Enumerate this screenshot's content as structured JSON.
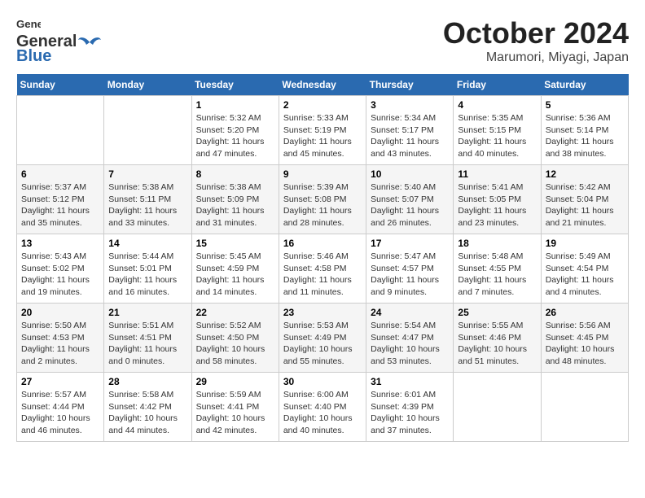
{
  "logo": {
    "general": "General",
    "blue": "Blue"
  },
  "title": "October 2024",
  "location": "Marumori, Miyagi, Japan",
  "days_of_week": [
    "Sunday",
    "Monday",
    "Tuesday",
    "Wednesday",
    "Thursday",
    "Friday",
    "Saturday"
  ],
  "weeks": [
    [
      {
        "day": "",
        "sunrise": "",
        "sunset": "",
        "daylight": ""
      },
      {
        "day": "",
        "sunrise": "",
        "sunset": "",
        "daylight": ""
      },
      {
        "day": "1",
        "sunrise": "Sunrise: 5:32 AM",
        "sunset": "Sunset: 5:20 PM",
        "daylight": "Daylight: 11 hours and 47 minutes."
      },
      {
        "day": "2",
        "sunrise": "Sunrise: 5:33 AM",
        "sunset": "Sunset: 5:19 PM",
        "daylight": "Daylight: 11 hours and 45 minutes."
      },
      {
        "day": "3",
        "sunrise": "Sunrise: 5:34 AM",
        "sunset": "Sunset: 5:17 PM",
        "daylight": "Daylight: 11 hours and 43 minutes."
      },
      {
        "day": "4",
        "sunrise": "Sunrise: 5:35 AM",
        "sunset": "Sunset: 5:15 PM",
        "daylight": "Daylight: 11 hours and 40 minutes."
      },
      {
        "day": "5",
        "sunrise": "Sunrise: 5:36 AM",
        "sunset": "Sunset: 5:14 PM",
        "daylight": "Daylight: 11 hours and 38 minutes."
      }
    ],
    [
      {
        "day": "6",
        "sunrise": "Sunrise: 5:37 AM",
        "sunset": "Sunset: 5:12 PM",
        "daylight": "Daylight: 11 hours and 35 minutes."
      },
      {
        "day": "7",
        "sunrise": "Sunrise: 5:38 AM",
        "sunset": "Sunset: 5:11 PM",
        "daylight": "Daylight: 11 hours and 33 minutes."
      },
      {
        "day": "8",
        "sunrise": "Sunrise: 5:38 AM",
        "sunset": "Sunset: 5:09 PM",
        "daylight": "Daylight: 11 hours and 31 minutes."
      },
      {
        "day": "9",
        "sunrise": "Sunrise: 5:39 AM",
        "sunset": "Sunset: 5:08 PM",
        "daylight": "Daylight: 11 hours and 28 minutes."
      },
      {
        "day": "10",
        "sunrise": "Sunrise: 5:40 AM",
        "sunset": "Sunset: 5:07 PM",
        "daylight": "Daylight: 11 hours and 26 minutes."
      },
      {
        "day": "11",
        "sunrise": "Sunrise: 5:41 AM",
        "sunset": "Sunset: 5:05 PM",
        "daylight": "Daylight: 11 hours and 23 minutes."
      },
      {
        "day": "12",
        "sunrise": "Sunrise: 5:42 AM",
        "sunset": "Sunset: 5:04 PM",
        "daylight": "Daylight: 11 hours and 21 minutes."
      }
    ],
    [
      {
        "day": "13",
        "sunrise": "Sunrise: 5:43 AM",
        "sunset": "Sunset: 5:02 PM",
        "daylight": "Daylight: 11 hours and 19 minutes."
      },
      {
        "day": "14",
        "sunrise": "Sunrise: 5:44 AM",
        "sunset": "Sunset: 5:01 PM",
        "daylight": "Daylight: 11 hours and 16 minutes."
      },
      {
        "day": "15",
        "sunrise": "Sunrise: 5:45 AM",
        "sunset": "Sunset: 4:59 PM",
        "daylight": "Daylight: 11 hours and 14 minutes."
      },
      {
        "day": "16",
        "sunrise": "Sunrise: 5:46 AM",
        "sunset": "Sunset: 4:58 PM",
        "daylight": "Daylight: 11 hours and 11 minutes."
      },
      {
        "day": "17",
        "sunrise": "Sunrise: 5:47 AM",
        "sunset": "Sunset: 4:57 PM",
        "daylight": "Daylight: 11 hours and 9 minutes."
      },
      {
        "day": "18",
        "sunrise": "Sunrise: 5:48 AM",
        "sunset": "Sunset: 4:55 PM",
        "daylight": "Daylight: 11 hours and 7 minutes."
      },
      {
        "day": "19",
        "sunrise": "Sunrise: 5:49 AM",
        "sunset": "Sunset: 4:54 PM",
        "daylight": "Daylight: 11 hours and 4 minutes."
      }
    ],
    [
      {
        "day": "20",
        "sunrise": "Sunrise: 5:50 AM",
        "sunset": "Sunset: 4:53 PM",
        "daylight": "Daylight: 11 hours and 2 minutes."
      },
      {
        "day": "21",
        "sunrise": "Sunrise: 5:51 AM",
        "sunset": "Sunset: 4:51 PM",
        "daylight": "Daylight: 11 hours and 0 minutes."
      },
      {
        "day": "22",
        "sunrise": "Sunrise: 5:52 AM",
        "sunset": "Sunset: 4:50 PM",
        "daylight": "Daylight: 10 hours and 58 minutes."
      },
      {
        "day": "23",
        "sunrise": "Sunrise: 5:53 AM",
        "sunset": "Sunset: 4:49 PM",
        "daylight": "Daylight: 10 hours and 55 minutes."
      },
      {
        "day": "24",
        "sunrise": "Sunrise: 5:54 AM",
        "sunset": "Sunset: 4:47 PM",
        "daylight": "Daylight: 10 hours and 53 minutes."
      },
      {
        "day": "25",
        "sunrise": "Sunrise: 5:55 AM",
        "sunset": "Sunset: 4:46 PM",
        "daylight": "Daylight: 10 hours and 51 minutes."
      },
      {
        "day": "26",
        "sunrise": "Sunrise: 5:56 AM",
        "sunset": "Sunset: 4:45 PM",
        "daylight": "Daylight: 10 hours and 48 minutes."
      }
    ],
    [
      {
        "day": "27",
        "sunrise": "Sunrise: 5:57 AM",
        "sunset": "Sunset: 4:44 PM",
        "daylight": "Daylight: 10 hours and 46 minutes."
      },
      {
        "day": "28",
        "sunrise": "Sunrise: 5:58 AM",
        "sunset": "Sunset: 4:42 PM",
        "daylight": "Daylight: 10 hours and 44 minutes."
      },
      {
        "day": "29",
        "sunrise": "Sunrise: 5:59 AM",
        "sunset": "Sunset: 4:41 PM",
        "daylight": "Daylight: 10 hours and 42 minutes."
      },
      {
        "day": "30",
        "sunrise": "Sunrise: 6:00 AM",
        "sunset": "Sunset: 4:40 PM",
        "daylight": "Daylight: 10 hours and 40 minutes."
      },
      {
        "day": "31",
        "sunrise": "Sunrise: 6:01 AM",
        "sunset": "Sunset: 4:39 PM",
        "daylight": "Daylight: 10 hours and 37 minutes."
      },
      {
        "day": "",
        "sunrise": "",
        "sunset": "",
        "daylight": ""
      },
      {
        "day": "",
        "sunrise": "",
        "sunset": "",
        "daylight": ""
      }
    ]
  ]
}
